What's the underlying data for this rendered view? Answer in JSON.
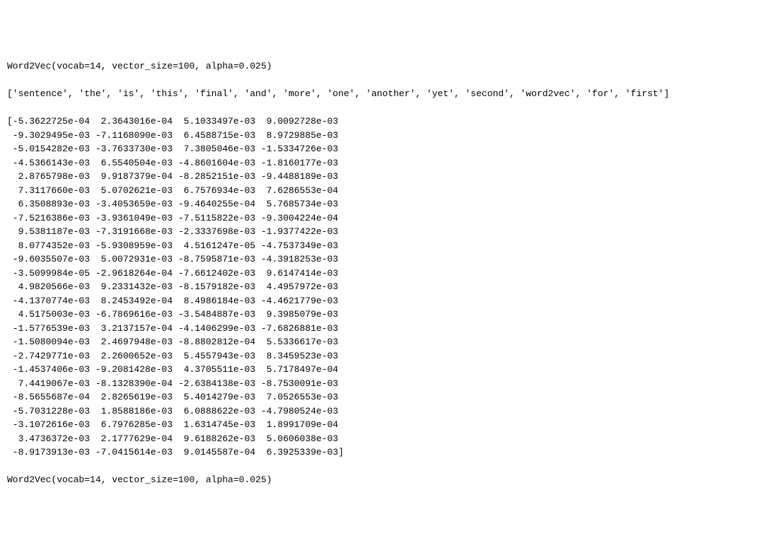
{
  "output": {
    "model_summary_1": "Word2Vec(vocab=14, vector_size=100, alpha=0.025)",
    "vocab_list": "['sentence', 'the', 'is', 'this', 'final', 'and', 'more', 'one', 'another', 'yet', 'second', 'word2vec', 'for', 'first']",
    "vector_rows": [
      "[-5.3622725e-04  2.3643016e-04  5.1033497e-03  9.0092728e-03",
      " -9.3029495e-03 -7.1168090e-03  6.4588715e-03  8.9729885e-03",
      " -5.0154282e-03 -3.7633730e-03  7.3805046e-03 -1.5334726e-03",
      " -4.5366143e-03  6.5540504e-03 -4.8601604e-03 -1.8160177e-03",
      "  2.8765798e-03  9.9187379e-04 -8.2852151e-03 -9.4488189e-03",
      "  7.3117660e-03  5.0702621e-03  6.7576934e-03  7.6286553e-04",
      "  6.3508893e-03 -3.4053659e-03 -9.4640255e-04  5.7685734e-03",
      " -7.5216386e-03 -3.9361049e-03 -7.5115822e-03 -9.3004224e-04",
      "  9.5381187e-03 -7.3191668e-03 -2.3337698e-03 -1.9377422e-03",
      "  8.0774352e-03 -5.9308959e-03  4.5161247e-05 -4.7537349e-03",
      " -9.6035507e-03  5.0072931e-03 -8.7595871e-03 -4.3918253e-03",
      " -3.5099984e-05 -2.9618264e-04 -7.6612402e-03  9.6147414e-03",
      "  4.9820566e-03  9.2331432e-03 -8.1579182e-03  4.4957972e-03",
      " -4.1370774e-03  8.2453492e-04  8.4986184e-03 -4.4621779e-03",
      "  4.5175003e-03 -6.7869616e-03 -3.5484887e-03  9.3985079e-03",
      " -1.5776539e-03  3.2137157e-04 -4.1406299e-03 -7.6826881e-03",
      " -1.5080094e-03  2.4697948e-03 -8.8802812e-04  5.5336617e-03",
      " -2.7429771e-03  2.2600652e-03  5.4557943e-03  8.3459523e-03",
      " -1.4537406e-03 -9.2081428e-03  4.3705511e-03  5.7178497e-04",
      "  7.4419067e-03 -8.1328390e-04 -2.6384138e-03 -8.7530091e-03",
      " -8.5655687e-04  2.8265619e-03  5.4014279e-03  7.0526553e-03",
      " -5.7031228e-03  1.8588186e-03  6.0888622e-03 -4.7980524e-03",
      " -3.1072616e-03  6.7976285e-03  1.6314745e-03  1.8991709e-04",
      "  3.4736372e-03  2.1777629e-04  9.6188262e-03  5.0606038e-03",
      " -8.9173913e-03 -7.0415614e-03  9.0145587e-04  6.3925339e-03]"
    ],
    "model_summary_2": "Word2Vec(vocab=14, vector_size=100, alpha=0.025)"
  }
}
